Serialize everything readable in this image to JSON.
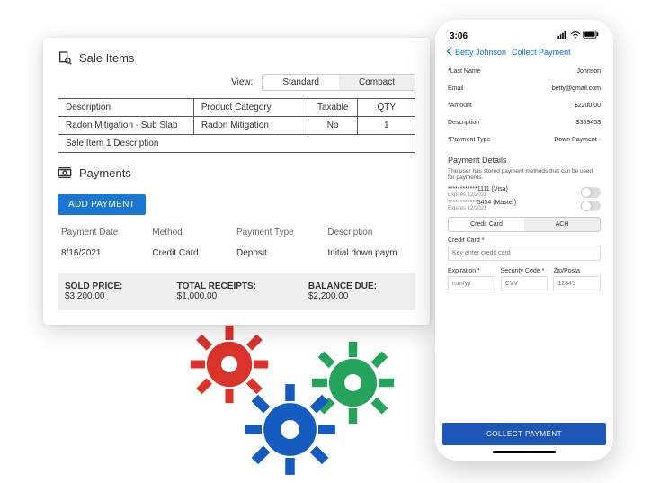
{
  "colors": {
    "primary": "#1976d2",
    "collect": "#1e56b5",
    "gear_red": "#d9332a",
    "gear_green": "#24a35a",
    "gear_blue": "#155cc0"
  },
  "desktop": {
    "sale_title": "Sale Items",
    "view_label": "View:",
    "view_options": {
      "standard": "Standard",
      "compact": "Compact"
    },
    "sale_headers": {
      "description": "Description",
      "category": "Product Category",
      "taxable": "Taxable",
      "qty": "QTY"
    },
    "sale_row": {
      "description": "Radon Mitigation - Sub Slab",
      "category": "Radon Mitigation",
      "taxable": "No",
      "qty": "1"
    },
    "sale_desc_row": "Sale Item 1 Description",
    "payments_title": "Payments",
    "add_payment_btn": "ADD PAYMENT",
    "pay_headers": {
      "date": "Payment Date",
      "method": "Method",
      "type": "Payment Type",
      "description": "Description"
    },
    "pay_row": {
      "date": "8/16/2021",
      "method": "Credit Card",
      "type": "Deposit",
      "description": "Initial down paym"
    },
    "totals": {
      "sold_label": "SOLD PRICE:",
      "sold_value": "$3,200.00",
      "receipts_label": "TOTAL RECEIPTS:",
      "receipts_value": "$1,000.00",
      "balance_label": "BALANCE DUE:",
      "balance_value": "$2,200.00"
    }
  },
  "phone": {
    "status_time": "3:06",
    "back_label": "Betty Johnson",
    "screen_title": "Collect Payment",
    "fields": {
      "last_name_label": "*Last Name",
      "last_name_value": "Johnson",
      "email_label": "Email",
      "email_value": "betty@gmail.com",
      "amount_label": "*Amount",
      "amount_value": "$2200.00",
      "description_label": "Description",
      "description_value": "S359453",
      "ptype_label": "*Payment Type",
      "ptype_value": "Down Payment"
    },
    "payment_details_title": "Payment Details",
    "payment_details_help": "The user has stored payment methods that can be used for payments.",
    "methods": [
      {
        "mask": "************1111 (Visa)",
        "expires": "Expires 12/2021"
      },
      {
        "mask": "************5454 (Master)",
        "expires": "Expires 12/2021"
      }
    ],
    "tabs": {
      "cc": "Credit Card",
      "ach": "ACH"
    },
    "cc_label": "Credit Card *",
    "cc_placeholder": "Key enter credit card",
    "exp_label": "Expiration *",
    "exp_placeholder": "mm/yy",
    "cvv_label": "Security Code *",
    "cvv_placeholder": "CVV",
    "zip_label": "Zip/Posta",
    "zip_placeholder": "12345",
    "collect_btn": "COLLECT PAYMENT"
  }
}
